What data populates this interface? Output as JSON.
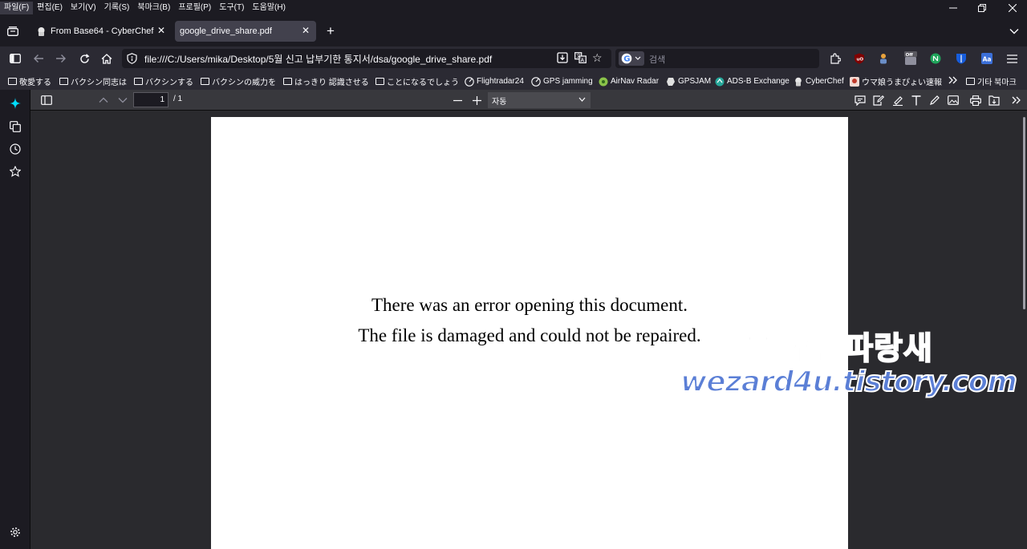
{
  "menubar": {
    "items": [
      "파일(F)",
      "편집(E)",
      "보기(V)",
      "기록(S)",
      "북마크(B)",
      "프로필(P)",
      "도구(T)",
      "도움말(H)"
    ]
  },
  "tabs": [
    {
      "title": "From Base64 - CyberChef",
      "icon": "cyberchef-icon"
    },
    {
      "title": "google_drive_share.pdf",
      "icon": "none"
    }
  ],
  "navbar": {
    "url": "file:///C:/Users/mika/Desktop/5월 신고 납부기한 통지서/dsa/google_drive_share.pdf",
    "search_placeholder": "검색"
  },
  "bookmarks": [
    {
      "label": "敬愛する",
      "icon": "folder-icon"
    },
    {
      "label": "バクシン同志は",
      "icon": "folder-icon"
    },
    {
      "label": "バクシンする",
      "icon": "folder-icon"
    },
    {
      "label": "バクシンの威力を",
      "icon": "folder-icon"
    },
    {
      "label": "はっきり 認識させる",
      "icon": "folder-icon"
    },
    {
      "label": "ことになるでしょう",
      "icon": "folder-icon"
    },
    {
      "label": "Flightradar24",
      "icon": "radar-icon"
    },
    {
      "label": "GPS jamming",
      "icon": "radar-icon"
    },
    {
      "label": "AirNav Radar",
      "icon": "airnav-icon"
    },
    {
      "label": "GPSJAM",
      "icon": "gpsjam-icon"
    },
    {
      "label": "ADS-B Exchange",
      "icon": "adsb-icon"
    },
    {
      "label": "CyberChef",
      "icon": "cyberchef-icon"
    },
    {
      "label": "ウマ娘うまぴょい速報",
      "icon": "umamusume-icon"
    },
    {
      "label": "기타 북마크",
      "icon": "folder-icon"
    }
  ],
  "pdf_toolbar": {
    "page_number": "1",
    "page_total": "/ 1",
    "zoom": "자동"
  },
  "document": {
    "error_line1": "There was an error opening this document.",
    "error_line2": "The file is damaged and could not be repaired."
  },
  "watermark": {
    "korean": "꿈을 꾸는파랑새",
    "english": "wezard4u.tistory.com"
  },
  "colors": {
    "chrome_dark": "#1c1b22",
    "toolbar": "#2b2a33",
    "pdf_toolbar": "#38383d",
    "viewer_bg": "#2a2a2e",
    "accent": "#0df"
  }
}
